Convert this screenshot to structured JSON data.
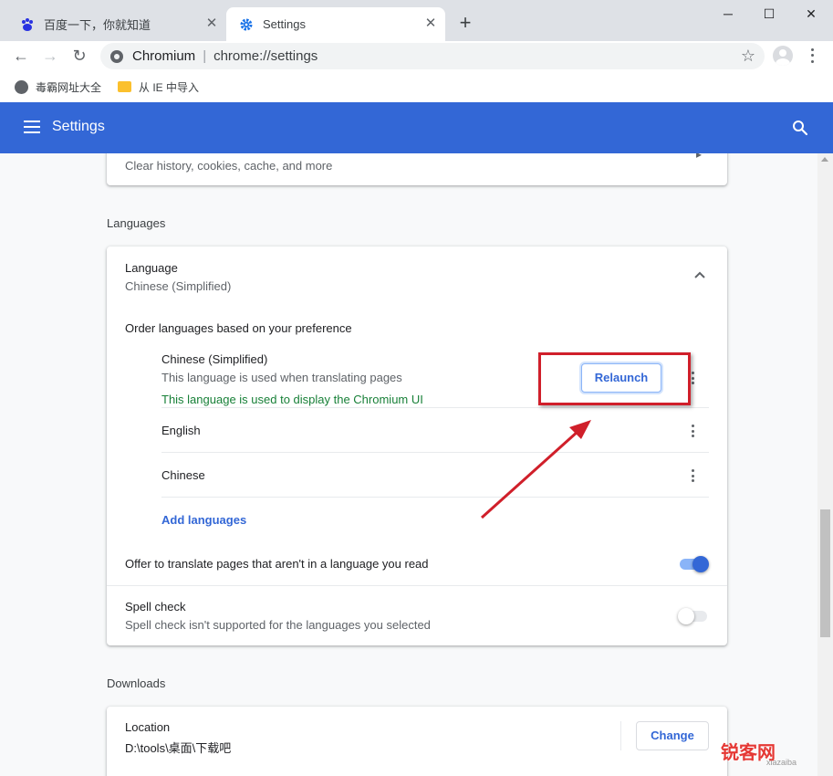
{
  "browser": {
    "tabs": [
      {
        "title": "百度一下，你就知道"
      },
      {
        "title": "Settings"
      }
    ],
    "omnibox": {
      "site": "Chromium",
      "separator": "|",
      "url": "chrome://settings"
    },
    "bookmarks": [
      {
        "label": "毒霸网址大全",
        "icon": "globe-icon"
      },
      {
        "label": "从 IE 中导入",
        "icon": "folder-icon"
      }
    ]
  },
  "header": {
    "title": "Settings"
  },
  "privacy_card": {
    "clear_browsing_secondary": "Clear history, cookies, cache, and more"
  },
  "languages": {
    "section_title": "Languages",
    "language_label": "Language",
    "language_value": "Chinese (Simplified)",
    "order_label": "Order languages based on your preference",
    "items": [
      {
        "name": "Chinese (Simplified)",
        "note1": "This language is used when translating pages",
        "note2": "This language is used to display the Chromium UI",
        "button": "Relaunch"
      },
      {
        "name": "English"
      },
      {
        "name": "Chinese"
      }
    ],
    "add_languages": "Add languages",
    "offer_translate": "Offer to translate pages that aren't in a language you read",
    "offer_translate_on": true,
    "spell_check": "Spell check",
    "spell_check_secondary": "Spell check isn't supported for the languages you selected",
    "spell_check_on": false
  },
  "downloads": {
    "section_title": "Downloads",
    "location_label": "Location",
    "location_value": "D:\\tools\\桌面\\下载吧",
    "change_button": "Change"
  },
  "watermark": {
    "text": "锐客网",
    "subtext": "xiazaiba"
  },
  "colors": {
    "header_blue": "#3367d6",
    "tabstrip": "#dee1e6",
    "green_text": "#188038",
    "highlight_red": "#d01f2a"
  }
}
